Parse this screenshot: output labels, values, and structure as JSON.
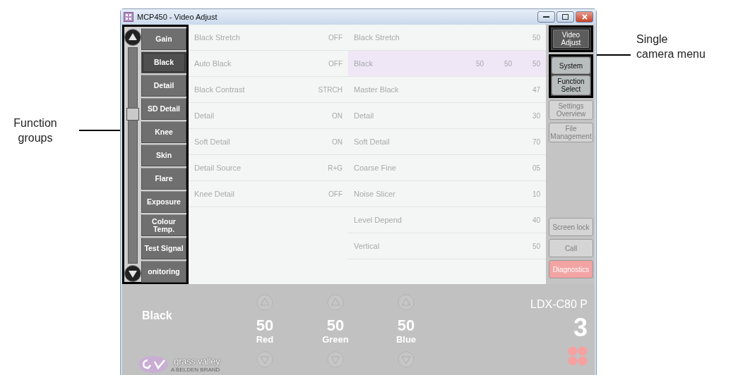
{
  "window": {
    "title": "MCP450 - Video Adjust"
  },
  "function_groups": {
    "items": [
      {
        "label": "Gain",
        "selected": false
      },
      {
        "label": "Black",
        "selected": true
      },
      {
        "label": "Detail",
        "selected": false
      },
      {
        "label": "SD Detail",
        "selected": false
      },
      {
        "label": "Knee",
        "selected": false
      },
      {
        "label": "Skin",
        "selected": false
      },
      {
        "label": "Flare",
        "selected": false
      },
      {
        "label": "Exposure",
        "selected": false
      },
      {
        "label": "Colour Temp.",
        "selected": false
      },
      {
        "label": "Test Signal",
        "selected": false
      },
      {
        "label": "onitoring",
        "selected": false
      }
    ]
  },
  "table": {
    "left_rows": [
      {
        "label": "Black Stretch",
        "value": "OFF"
      },
      {
        "label": "Auto Black",
        "value": "OFF"
      },
      {
        "label": "Black Contrast",
        "value": "STRCH"
      },
      {
        "label": "Detail",
        "value": "ON"
      },
      {
        "label": "Soft Detail",
        "value": "ON"
      },
      {
        "label": "Detail Source",
        "value": "R+G"
      },
      {
        "label": "Knee Detail",
        "value": "OFF"
      }
    ],
    "right_rows": [
      {
        "label": "Black Stretch",
        "values": [
          "50"
        ],
        "selected": false
      },
      {
        "label": "Black",
        "values": [
          "50",
          "50",
          "50"
        ],
        "selected": true
      },
      {
        "label": "Master Black",
        "values": [
          "47"
        ],
        "selected": false
      },
      {
        "label": "Detail",
        "values": [
          "30"
        ],
        "selected": false
      },
      {
        "label": "Soft Detail",
        "values": [
          "70"
        ],
        "selected": false
      },
      {
        "label": "Coarse Fine",
        "values": [
          "05"
        ],
        "selected": false
      },
      {
        "label": "Noise Slicer",
        "values": [
          "10"
        ],
        "selected": false
      },
      {
        "label": "Level Depend",
        "values": [
          "40"
        ],
        "selected": false
      },
      {
        "label": "Vertical",
        "values": [
          "50"
        ],
        "selected": false
      }
    ]
  },
  "side_menu": {
    "groups": [
      {
        "framed": true,
        "items": [
          {
            "label": "Video Adjust",
            "kind": "menu",
            "selected": true,
            "disabled": false
          }
        ]
      },
      {
        "framed": true,
        "items": [
          {
            "label": "System",
            "kind": "menu",
            "selected": false,
            "disabled": false
          },
          {
            "label": "Function Select",
            "kind": "menu",
            "selected": false,
            "disabled": false
          }
        ]
      },
      {
        "framed": false,
        "items": [
          {
            "label": "Settings Overview",
            "kind": "menu",
            "selected": false,
            "disabled": true
          },
          {
            "label": "File Management",
            "kind": "menu",
            "selected": false,
            "disabled": true
          }
        ]
      },
      {
        "framed": false,
        "items": [
          {
            "label": "Screen lock",
            "kind": "utility",
            "selected": false,
            "disabled": true
          },
          {
            "label": "Call",
            "kind": "utility",
            "selected": false,
            "disabled": true
          },
          {
            "label": "Diagnostics",
            "kind": "alert",
            "selected": false,
            "disabled": true
          }
        ]
      }
    ]
  },
  "control": {
    "function": "Black",
    "channels": [
      {
        "value": "50",
        "name": "Red"
      },
      {
        "value": "50",
        "name": "Green"
      },
      {
        "value": "50",
        "name": "Blue"
      }
    ],
    "camera_model": "LDX-C80 P",
    "camera_number": "3"
  },
  "logo": {
    "name": "grass valley",
    "tagline": "A BELDEN BRAND"
  },
  "callouts": [
    {
      "lines": [
        "Function",
        "groups"
      ]
    },
    {
      "lines": [
        "Single",
        "camera menu"
      ]
    }
  ]
}
